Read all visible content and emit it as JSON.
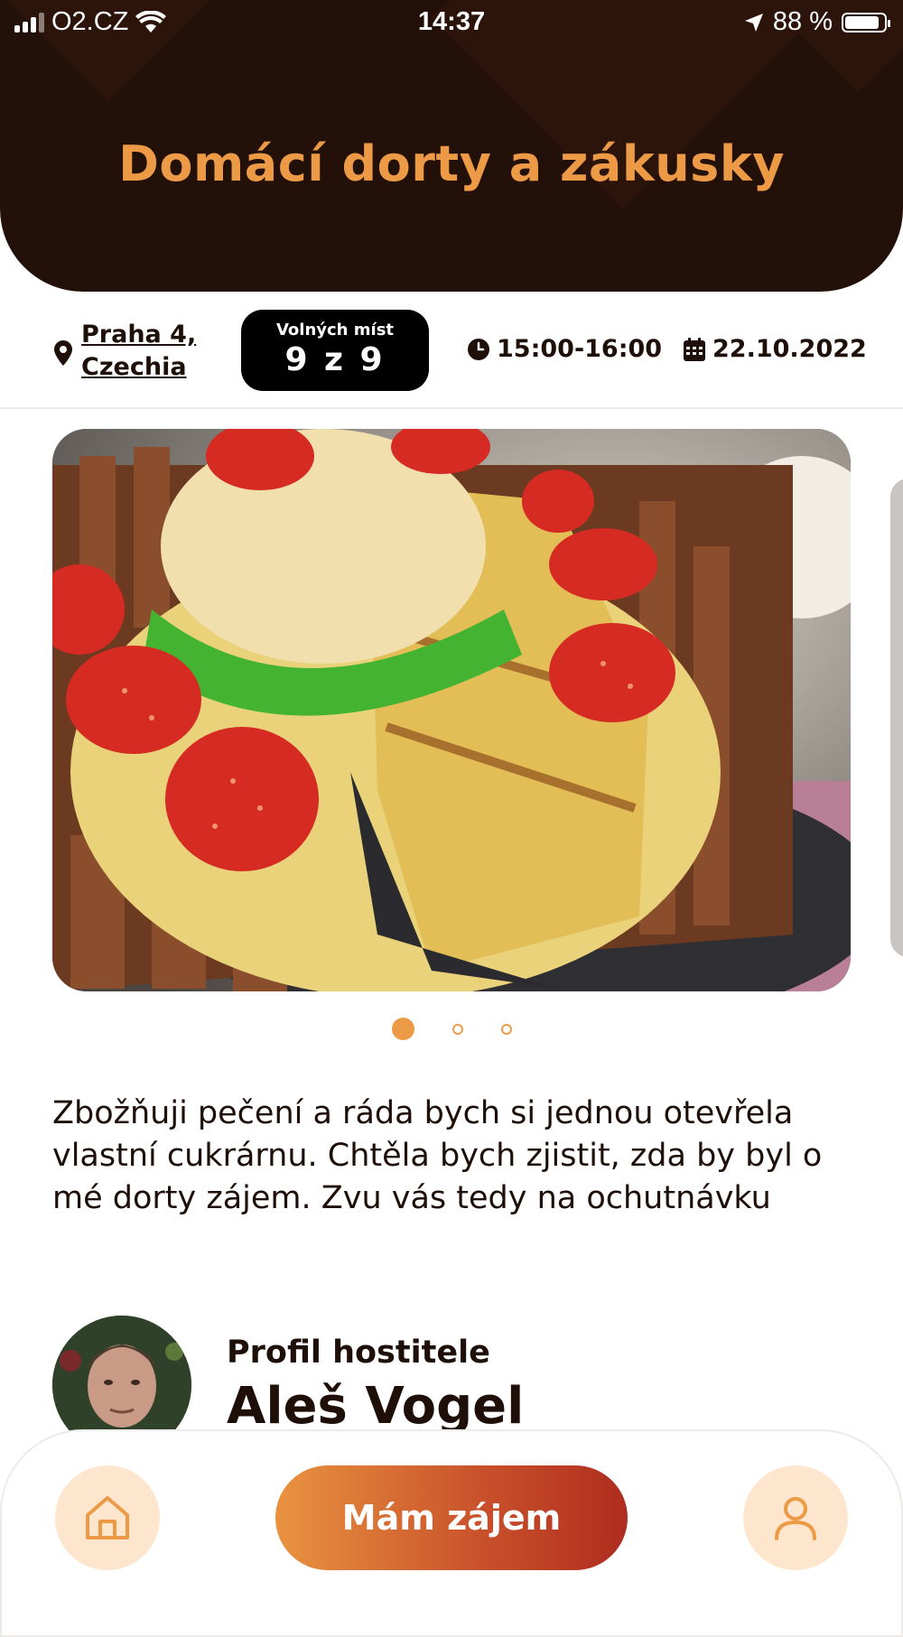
{
  "status_bar": {
    "carrier": "O2.CZ",
    "time": "14:37",
    "battery": "88 %",
    "battery_level": 0.88
  },
  "header": {
    "title": "Domácí dorty a zákusky"
  },
  "info": {
    "location_line1": "Praha 4,",
    "location_line2": "Czechia",
    "seats_label": "Volných míst",
    "seats_value": "9 z 9",
    "time": "15:00-16:00",
    "date": "22.10.2022"
  },
  "carousel": {
    "image_icon": "cake-with-strawberries-photo",
    "pages": 3,
    "active_page": 1
  },
  "description": "Zbožňuji pečení a ráda bych si jednou otevřela vlastní cukrárnu. Chtěla bych zjistit, zda by byl o mé dorty zájem. Zvu vás tedy na ochutnávku",
  "host": {
    "label": "Profil hostitele",
    "name": "Aleš Vogel",
    "avatar_icon": "host-portrait-photo"
  },
  "bottom_nav": {
    "home_icon": "home-icon",
    "cta_label": "Mám zájem",
    "profile_icon": "user-icon"
  },
  "colors": {
    "accent": "#ec9a45",
    "header_bg": "#221009",
    "cta_start": "#e99340",
    "cta_end": "#ae2d1f",
    "nav_button_bg": "#fde6cd"
  }
}
